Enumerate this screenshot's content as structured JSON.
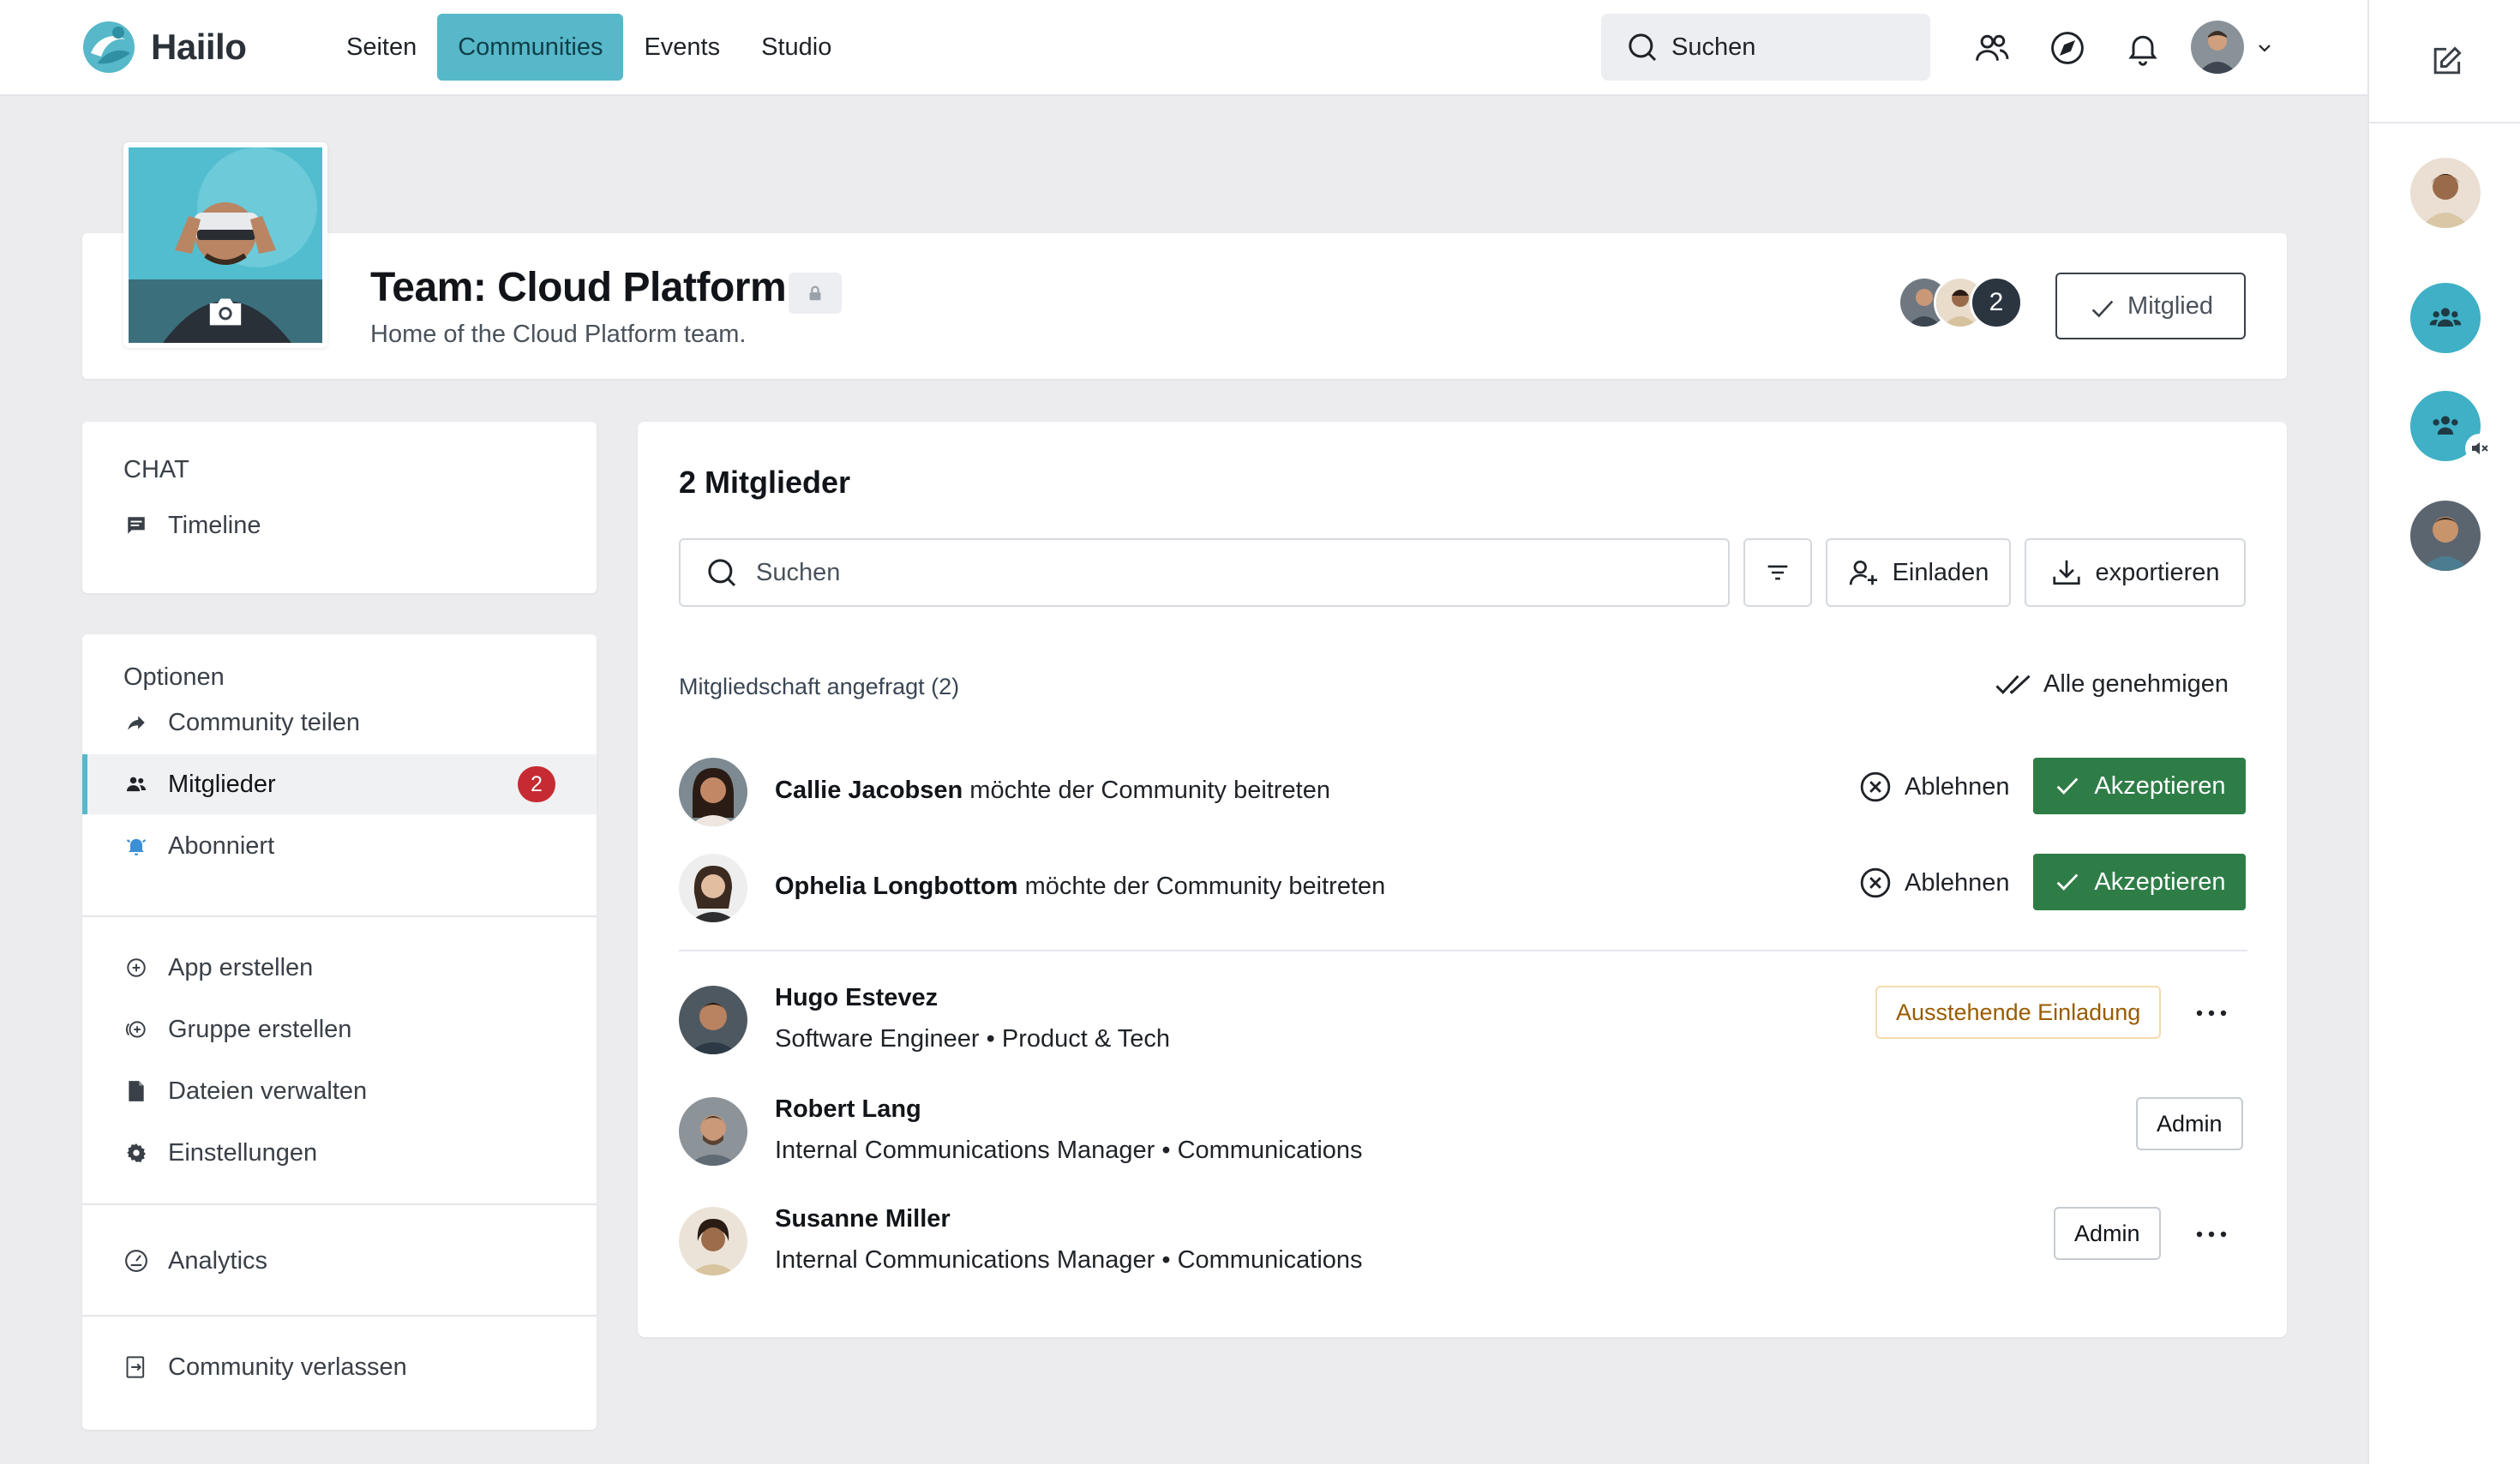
{
  "app": {
    "name": "Haiilo",
    "brand_color": "#56b8c9"
  },
  "nav": {
    "items": [
      {
        "label": "Seiten",
        "active": false
      },
      {
        "label": "Communities",
        "active": true
      },
      {
        "label": "Events",
        "active": false
      },
      {
        "label": "Studio",
        "active": false
      }
    ],
    "search_placeholder": "Suchen"
  },
  "community": {
    "title": "Team: Cloud Platform",
    "subtitle": "Home of the Cloud Platform team.",
    "member_count_badge": "2",
    "member_button": "Mitglied"
  },
  "sidebar": {
    "chat_heading": "CHAT",
    "chat_items": [
      {
        "label": "Timeline",
        "icon": "chat-icon"
      }
    ],
    "options_heading": "Optionen",
    "option_items": [
      {
        "label": "Community teilen",
        "icon": "share-icon"
      },
      {
        "label": "Mitglieder",
        "icon": "members-icon",
        "badge": "2",
        "active": true
      },
      {
        "label": "Abonniert",
        "icon": "bell-icon"
      }
    ],
    "create_items": [
      {
        "label": "App erstellen",
        "icon": "plus-circle-icon"
      },
      {
        "label": "Gruppe erstellen",
        "icon": "group-add-icon"
      },
      {
        "label": "Dateien verwalten",
        "icon": "file-icon"
      },
      {
        "label": "Einstellungen",
        "icon": "gear-icon"
      }
    ],
    "analytics": "Analytics",
    "leave": "Community verlassen"
  },
  "members": {
    "title": "2 Mitglieder",
    "search_placeholder": "Suchen",
    "invite_label": "Einladen",
    "export_label": "exportieren",
    "requests_heading": "Mitgliedschaft angefragt (2)",
    "approve_all": "Alle genehmigen",
    "requests": [
      {
        "name": "Callie Jacobsen",
        "text": "möchte der Community beitreten",
        "decline": "Ablehnen",
        "accept": "Akzeptieren"
      },
      {
        "name": "Ophelia Longbottom",
        "text": "möchte der Community beitreten",
        "decline": "Ablehnen",
        "accept": "Akzeptieren"
      }
    ],
    "list": [
      {
        "name": "Hugo Estevez",
        "role": "Software Engineer",
        "dept": "Product & Tech",
        "badge": "Ausstehende Einladung",
        "badge_type": "pending",
        "more": true
      },
      {
        "name": "Robert Lang",
        "role": "Internal Communications Manager",
        "dept": "Communications",
        "badge": "Admin",
        "badge_type": "admin",
        "more": false
      },
      {
        "name": "Susanne Miller",
        "role": "Internal Communications Manager",
        "dept": "Communications",
        "badge": "Admin",
        "badge_type": "admin",
        "more": true
      }
    ]
  },
  "colors": {
    "accept": "#2e7d47",
    "badge_red": "#c62b31",
    "pending": "#9a5b00",
    "accent": "#56b8c9"
  }
}
